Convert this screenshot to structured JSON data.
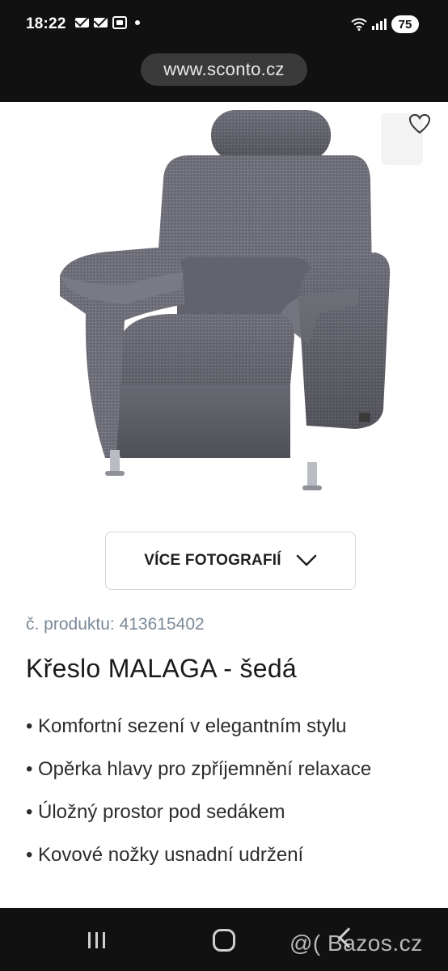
{
  "status_bar": {
    "time": "18:22",
    "battery": "75",
    "icons": [
      "mail-icon",
      "mail-icon",
      "screenshot-icon",
      "dot-icon",
      "wifi-icon",
      "signal-icon",
      "battery-icon"
    ]
  },
  "browser": {
    "url": "www.sconto.cz"
  },
  "product": {
    "image_alt": "armchair-photo",
    "favorite_icon": "heart-icon",
    "more_photos_label": "VÍCE FOTOGRAFIÍ",
    "more_photos_icon": "chevron-down-icon",
    "sku_label": "č. produktu:",
    "sku_value": "413615402",
    "title": "Křeslo MALAGA - šedá",
    "features": [
      "Komfortní sezení v elegantním stylu",
      "Opěrka hlavy pro zpříjemnění relaxace",
      "Úložný prostor pod sedákem",
      "Kovové nožky usnadní udržení"
    ]
  },
  "nav_bar": {
    "icons": [
      "recent-apps-icon",
      "home-icon",
      "back-icon"
    ]
  },
  "watermark": "@( Bazos.cz",
  "colors": {
    "system_bar": "#111111",
    "url_pill": "#3a3a3a",
    "sku_text": "#7a8a99",
    "title_text": "#1a1a1a",
    "fabric": "#6b6b76"
  }
}
